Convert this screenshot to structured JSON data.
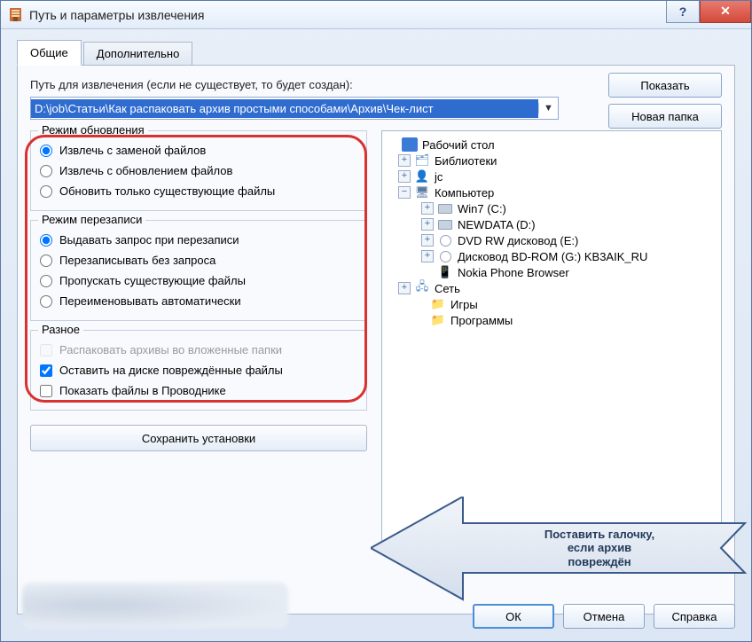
{
  "window": {
    "title": "Путь и параметры извлечения"
  },
  "tabs": {
    "general": "Общие",
    "advanced": "Дополнительно"
  },
  "path": {
    "label": "Путь для извлечения (если не существует, то будет создан):",
    "value": "D:\\job\\Статьи\\Как распаковать архив простыми способами\\Архив\\Чек-лист",
    "show_btn": "Показать",
    "newfolder_btn": "Новая папка"
  },
  "group_update": {
    "legend": "Режим обновления",
    "r1": "Извлечь с заменой файлов",
    "r2": "Извлечь с обновлением файлов",
    "r3": "Обновить только существующие файлы"
  },
  "group_overwrite": {
    "legend": "Режим перезаписи",
    "r1": "Выдавать запрос при перезаписи",
    "r2": "Перезаписывать без запроса",
    "r3": "Пропускать существующие файлы",
    "r4": "Переименовывать автоматически"
  },
  "group_misc": {
    "legend": "Разное",
    "c1": "Распаковать архивы во вложенные папки",
    "c2": "Оставить на диске повреждённые файлы",
    "c3": "Показать файлы в Проводнике"
  },
  "save_btn": "Сохранить установки",
  "tree": {
    "desktop": "Рабочий стол",
    "libraries": "Библиотеки",
    "user": "jc",
    "computer": "Компьютер",
    "drive_c": "Win7 (C:)",
    "drive_d": "NEWDATA (D:)",
    "drive_e": "DVD RW дисковод (E:)",
    "drive_g": "Дисковод BD-ROM (G:) KB3AIK_RU",
    "nokia": "Nokia Phone Browser",
    "network": "Сеть",
    "games": "Игры",
    "programs": "Программы"
  },
  "callout": {
    "line1": "Поставить галочку,",
    "line2": "если архив",
    "line3": "повреждён"
  },
  "buttons": {
    "ok": "ОК",
    "cancel": "Отмена",
    "help": "Справка"
  }
}
